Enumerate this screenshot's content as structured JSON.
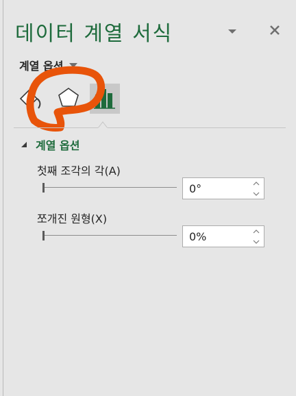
{
  "pane": {
    "title": "데이터 계열 서식",
    "menu_icon": "chevron-down-icon",
    "close_icon": "close-icon"
  },
  "series_options_menu": {
    "label": "계열 옵션",
    "icon": "caret-down-icon"
  },
  "tabs": [
    {
      "name": "fill-line",
      "icon": "paint-bucket-icon",
      "selected": false
    },
    {
      "name": "effects",
      "icon": "pentagon-icon",
      "selected": false
    },
    {
      "name": "series-options",
      "icon": "bar-chart-icon",
      "selected": true
    }
  ],
  "section": {
    "label": "계열 옵션",
    "expanded": true,
    "icon": "collapse-triangle-icon"
  },
  "fields": [
    {
      "label": "첫째 조각의 각(A)",
      "value": "0°",
      "slider_fraction": 0
    },
    {
      "label": "쪼개진 원형(X)",
      "value": "0%",
      "slider_fraction": 0
    }
  ],
  "colors": {
    "accent": "#1e6b3c",
    "annotation": "#e8540a",
    "panel": "#e6e6e6"
  }
}
